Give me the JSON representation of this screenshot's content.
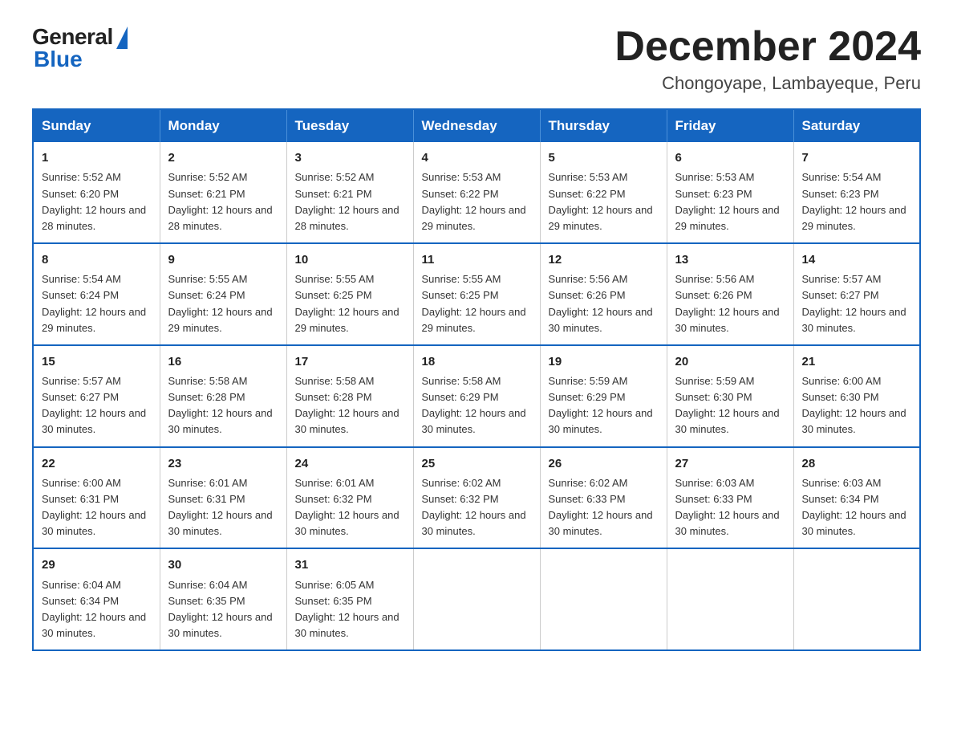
{
  "logo": {
    "general": "General",
    "blue": "Blue"
  },
  "title": "December 2024",
  "location": "Chongoyape, Lambayeque, Peru",
  "days_of_week": [
    "Sunday",
    "Monday",
    "Tuesday",
    "Wednesday",
    "Thursday",
    "Friday",
    "Saturday"
  ],
  "weeks": [
    [
      {
        "day": "1",
        "sunrise": "5:52 AM",
        "sunset": "6:20 PM",
        "daylight": "12 hours and 28 minutes."
      },
      {
        "day": "2",
        "sunrise": "5:52 AM",
        "sunset": "6:21 PM",
        "daylight": "12 hours and 28 minutes."
      },
      {
        "day": "3",
        "sunrise": "5:52 AM",
        "sunset": "6:21 PM",
        "daylight": "12 hours and 28 minutes."
      },
      {
        "day": "4",
        "sunrise": "5:53 AM",
        "sunset": "6:22 PM",
        "daylight": "12 hours and 29 minutes."
      },
      {
        "day": "5",
        "sunrise": "5:53 AM",
        "sunset": "6:22 PM",
        "daylight": "12 hours and 29 minutes."
      },
      {
        "day": "6",
        "sunrise": "5:53 AM",
        "sunset": "6:23 PM",
        "daylight": "12 hours and 29 minutes."
      },
      {
        "day": "7",
        "sunrise": "5:54 AM",
        "sunset": "6:23 PM",
        "daylight": "12 hours and 29 minutes."
      }
    ],
    [
      {
        "day": "8",
        "sunrise": "5:54 AM",
        "sunset": "6:24 PM",
        "daylight": "12 hours and 29 minutes."
      },
      {
        "day": "9",
        "sunrise": "5:55 AM",
        "sunset": "6:24 PM",
        "daylight": "12 hours and 29 minutes."
      },
      {
        "day": "10",
        "sunrise": "5:55 AM",
        "sunset": "6:25 PM",
        "daylight": "12 hours and 29 minutes."
      },
      {
        "day": "11",
        "sunrise": "5:55 AM",
        "sunset": "6:25 PM",
        "daylight": "12 hours and 29 minutes."
      },
      {
        "day": "12",
        "sunrise": "5:56 AM",
        "sunset": "6:26 PM",
        "daylight": "12 hours and 30 minutes."
      },
      {
        "day": "13",
        "sunrise": "5:56 AM",
        "sunset": "6:26 PM",
        "daylight": "12 hours and 30 minutes."
      },
      {
        "day": "14",
        "sunrise": "5:57 AM",
        "sunset": "6:27 PM",
        "daylight": "12 hours and 30 minutes."
      }
    ],
    [
      {
        "day": "15",
        "sunrise": "5:57 AM",
        "sunset": "6:27 PM",
        "daylight": "12 hours and 30 minutes."
      },
      {
        "day": "16",
        "sunrise": "5:58 AM",
        "sunset": "6:28 PM",
        "daylight": "12 hours and 30 minutes."
      },
      {
        "day": "17",
        "sunrise": "5:58 AM",
        "sunset": "6:28 PM",
        "daylight": "12 hours and 30 minutes."
      },
      {
        "day": "18",
        "sunrise": "5:58 AM",
        "sunset": "6:29 PM",
        "daylight": "12 hours and 30 minutes."
      },
      {
        "day": "19",
        "sunrise": "5:59 AM",
        "sunset": "6:29 PM",
        "daylight": "12 hours and 30 minutes."
      },
      {
        "day": "20",
        "sunrise": "5:59 AM",
        "sunset": "6:30 PM",
        "daylight": "12 hours and 30 minutes."
      },
      {
        "day": "21",
        "sunrise": "6:00 AM",
        "sunset": "6:30 PM",
        "daylight": "12 hours and 30 minutes."
      }
    ],
    [
      {
        "day": "22",
        "sunrise": "6:00 AM",
        "sunset": "6:31 PM",
        "daylight": "12 hours and 30 minutes."
      },
      {
        "day": "23",
        "sunrise": "6:01 AM",
        "sunset": "6:31 PM",
        "daylight": "12 hours and 30 minutes."
      },
      {
        "day": "24",
        "sunrise": "6:01 AM",
        "sunset": "6:32 PM",
        "daylight": "12 hours and 30 minutes."
      },
      {
        "day": "25",
        "sunrise": "6:02 AM",
        "sunset": "6:32 PM",
        "daylight": "12 hours and 30 minutes."
      },
      {
        "day": "26",
        "sunrise": "6:02 AM",
        "sunset": "6:33 PM",
        "daylight": "12 hours and 30 minutes."
      },
      {
        "day": "27",
        "sunrise": "6:03 AM",
        "sunset": "6:33 PM",
        "daylight": "12 hours and 30 minutes."
      },
      {
        "day": "28",
        "sunrise": "6:03 AM",
        "sunset": "6:34 PM",
        "daylight": "12 hours and 30 minutes."
      }
    ],
    [
      {
        "day": "29",
        "sunrise": "6:04 AM",
        "sunset": "6:34 PM",
        "daylight": "12 hours and 30 minutes."
      },
      {
        "day": "30",
        "sunrise": "6:04 AM",
        "sunset": "6:35 PM",
        "daylight": "12 hours and 30 minutes."
      },
      {
        "day": "31",
        "sunrise": "6:05 AM",
        "sunset": "6:35 PM",
        "daylight": "12 hours and 30 minutes."
      },
      null,
      null,
      null,
      null
    ]
  ],
  "labels": {
    "sunrise": "Sunrise:",
    "sunset": "Sunset:",
    "daylight": "Daylight:"
  }
}
